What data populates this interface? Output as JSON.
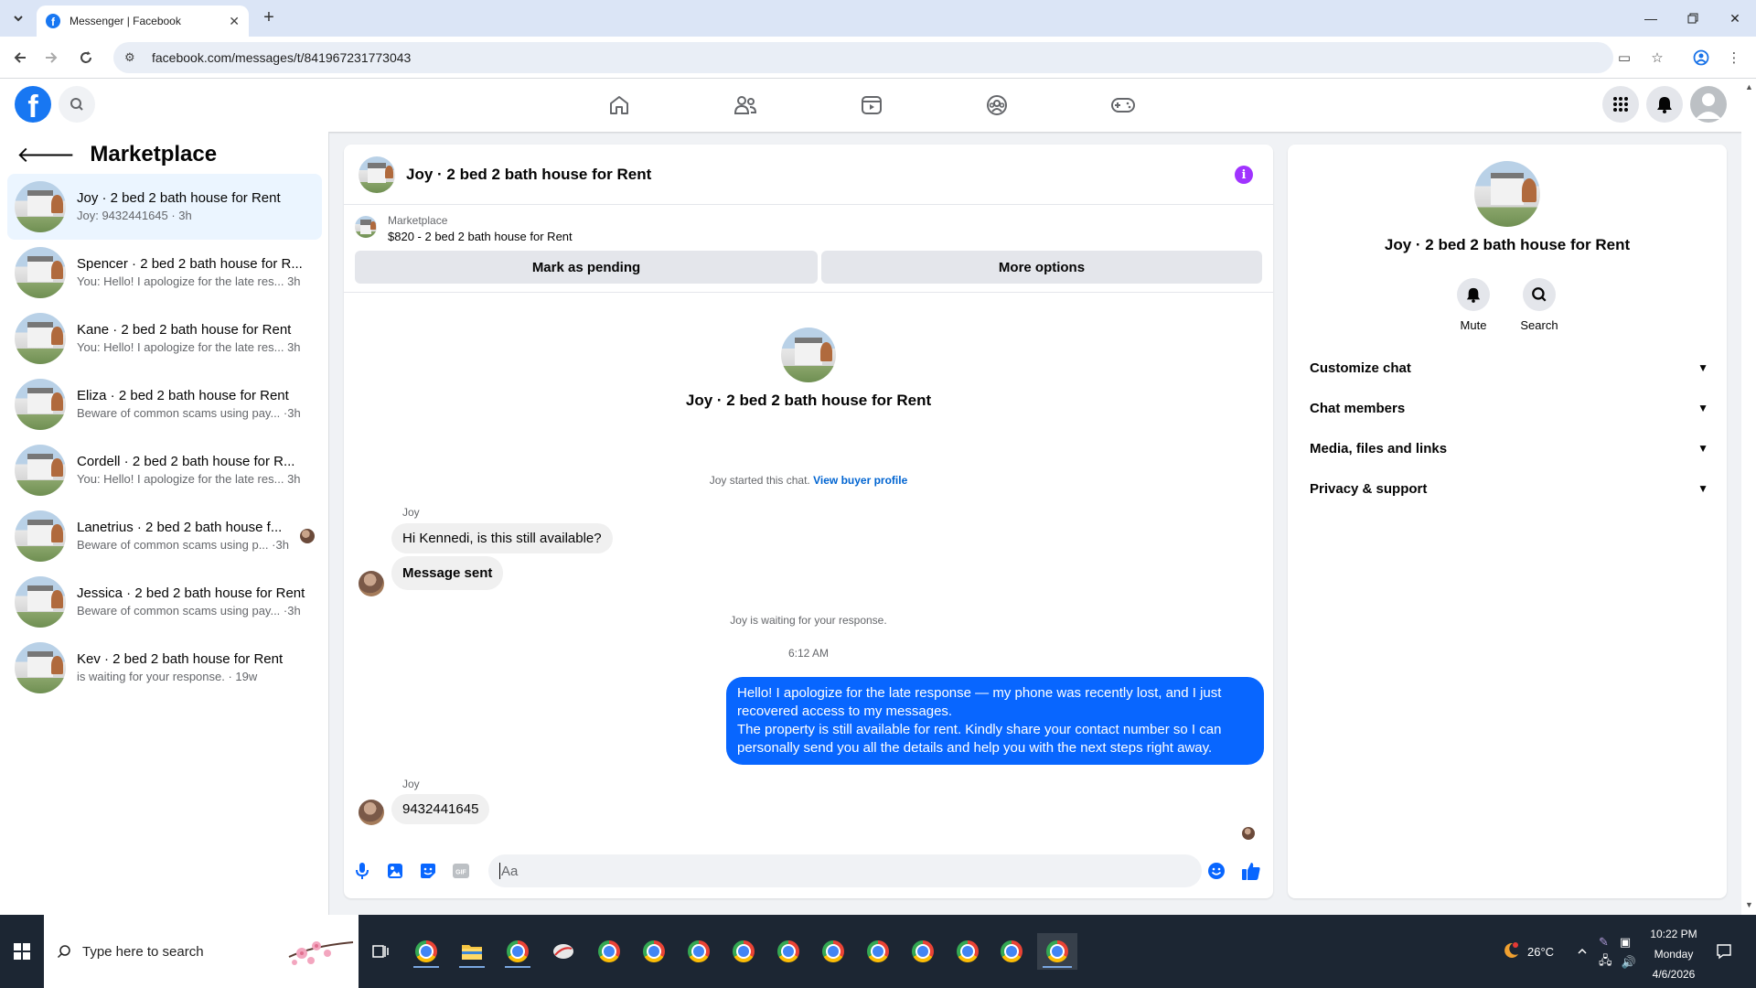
{
  "browser": {
    "tab_title": "Messenger | Facebook",
    "url": "facebook.com/messages/t/841967231773043"
  },
  "sidebar": {
    "title": "Marketplace",
    "chats": [
      {
        "name": "Joy · 2 bed 2 bath house for Rent",
        "preview": "Joy: 9432441645 · 3h",
        "active": true
      },
      {
        "name": "Spencer · 2 bed 2 bath house for R...",
        "preview": "You: Hello! I apologize for the late res...",
        "time": "3h"
      },
      {
        "name": "Kane · 2 bed 2 bath house for Rent",
        "preview": "You: Hello! I apologize for the late res...",
        "time": "3h"
      },
      {
        "name": "Eliza · 2 bed 2 bath house for Rent",
        "preview": "Beware of common scams using pay...",
        "time": "·3h"
      },
      {
        "name": "Cordell · 2 bed 2 bath house for R...",
        "preview": "You: Hello! I apologize for the late res...",
        "time": "3h"
      },
      {
        "name": "Lanetrius · 2 bed 2 bath house f...",
        "preview": "Beware of common scams using p...",
        "time": "·3h"
      },
      {
        "name": "Jessica · 2 bed 2 bath house for Rent",
        "preview": "Beware of common scams using pay...",
        "time": "·3h"
      },
      {
        "name": "Kev · 2 bed 2 bath house for Rent",
        "preview": "is waiting for your response. · 19w"
      }
    ]
  },
  "conversation": {
    "title": "Joy · 2 bed 2 bath house for Rent",
    "marketplace_label": "Marketplace",
    "listing": "$820 - 2 bed 2 bath house for Rent",
    "mark_pending": "Mark as pending",
    "more_options": "More options",
    "thread_name": "Joy · 2 bed 2 bath house for Rent",
    "started_text": "Joy started this chat.",
    "view_profile": "View buyer profile",
    "sender1": "Joy",
    "msg1": "Hi Kennedi, is this still available?",
    "msg2": "Message sent",
    "waiting": "Joy is waiting for your response.",
    "time": "6:12 AM",
    "out_line1": "Hello! I apologize for the late response — my phone was recently lost, and I just recovered access to my messages.",
    "out_line2": "The property is still available for rent. Kindly share your contact number so I can personally send you all the details and help you with the next steps right away.",
    "sender2": "Joy",
    "msg3": "9432441645",
    "composer_placeholder": "Aa"
  },
  "info_panel": {
    "name": "Joy · 2 bed 2 bath house for Rent",
    "mute_label": "Mute",
    "search_label": "Search",
    "sections": [
      "Customize chat",
      "Chat members",
      "Media, files and links",
      "Privacy & support"
    ]
  },
  "taskbar": {
    "search_placeholder": "Type here to search",
    "weather": "26°C",
    "time": "10:22 PM",
    "day": "Monday",
    "date": "4/6/2026"
  },
  "colors": {
    "fb_blue": "#1877f2",
    "outgoing_bubble": "#0866ff",
    "info_purple": "#a033ff",
    "active_chat": "#ebf5ff"
  }
}
